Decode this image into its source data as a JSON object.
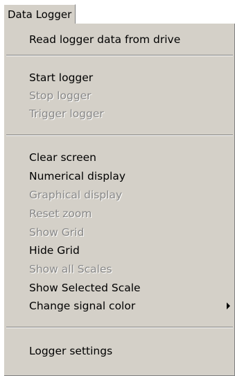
{
  "menu": {
    "title": "Data Logger",
    "items": [
      {
        "label": "Read logger data from drive",
        "enabled": true
      },
      {
        "label": "Start logger",
        "enabled": true
      },
      {
        "label": "Stop logger",
        "enabled": false
      },
      {
        "label": "Trigger logger",
        "enabled": false
      },
      {
        "label": "Clear screen",
        "enabled": true
      },
      {
        "label": "Numerical display",
        "enabled": true
      },
      {
        "label": "Graphical display",
        "enabled": false
      },
      {
        "label": "Reset zoom",
        "enabled": false
      },
      {
        "label": "Show Grid",
        "enabled": false
      },
      {
        "label": "Hide Grid",
        "enabled": true
      },
      {
        "label": "Show all Scales",
        "enabled": false
      },
      {
        "label": "Show Selected Scale",
        "enabled": true
      },
      {
        "label": "Change signal color",
        "enabled": true,
        "submenu": true
      },
      {
        "label": "Logger settings",
        "enabled": true
      }
    ]
  },
  "icons": {
    "submenu_arrow": "triangle-right"
  },
  "colors": {
    "menu_bg": "#d4d0c8",
    "text": "#000000",
    "disabled_text": "#888888",
    "highlight": "#ffffff",
    "shadow": "#808080"
  }
}
